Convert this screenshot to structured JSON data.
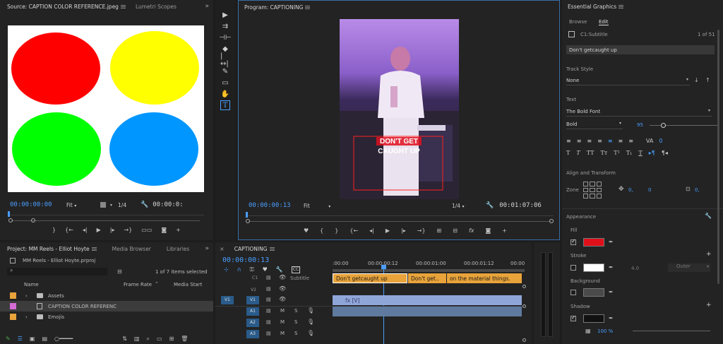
{
  "source": {
    "tab_label": "Source: CAPTION COLOR REFERENCE.jpeg",
    "tab2_label": "Lumetri Scopes",
    "timecode": "00:00:00:00",
    "fit_label": "Fit",
    "ratio_label": "1/4",
    "right_timecode": "00:00:0:",
    "circles": [
      {
        "name": "red-circle",
        "color": "#ff0000"
      },
      {
        "name": "yellow-circle",
        "color": "#ffff00"
      },
      {
        "name": "green-circle",
        "color": "#00ff00"
      },
      {
        "name": "blue-circle",
        "color": "#0096ff"
      }
    ]
  },
  "program": {
    "tab_label": "Program: CAPTIONING",
    "timecode": "00:00:00:13",
    "fit_label": "Fit",
    "ratio_label": "1/4",
    "duration": "00:01:07:06",
    "caption_line1": "DON'T GET",
    "caption_line2": "CAUGHT UP"
  },
  "essential": {
    "title": "Essential Graphics",
    "tab_browse": "Browse",
    "tab_edit": "Edit",
    "layer_name": "C1:Subtitle",
    "layer_count": "1 of 51",
    "text_value": "Don't getcaught up",
    "track_style_label": "Track Style",
    "track_style_value": "None",
    "text_section": "Text",
    "font_name": "The Bold Font",
    "font_style": "Bold",
    "font_size": "95",
    "tracking_value": "0",
    "align_section": "Align and Transform",
    "zone_label": "Zone",
    "pos_x": "0,",
    "pos_y": "0",
    "scale_value": "0,",
    "appearance_section": "Appearance",
    "fill_label": "Fill",
    "fill_color": "#e0101a",
    "stroke_label": "Stroke",
    "stroke_width": "4.0",
    "stroke_type": "Outer",
    "background_label": "Background",
    "shadow_label": "Shadow",
    "opacity_value": "100 %"
  },
  "project": {
    "tab_label": "Project: MM Reels - Elliot Hoyte",
    "tab2_label": "Media Browser",
    "tab3_label": "Libraries",
    "file_name": "MM Reels - Elliot Hoyte.prproj",
    "items_selected": "1 of 7 items selected",
    "col_name": "Name",
    "col_framerate": "Frame Rate",
    "col_mediastart": "Media Start",
    "rows": [
      {
        "label": "Assets",
        "color": "#e8a33a",
        "type": "folder"
      },
      {
        "label": "CAPTION COLOR REFERENC",
        "color": "#d46bd6",
        "type": "file"
      },
      {
        "label": "Emojis",
        "color": "#e8a33a",
        "type": "folder"
      }
    ]
  },
  "timeline": {
    "tab_label": "CAPTIONING",
    "timecode": "00:00:00:13",
    "ruler": [
      ":00:00",
      "00:00:00:12",
      "00:00:01:00",
      "00:00:01:12",
      "00:00"
    ],
    "subtitle_track": "Subtitle",
    "tracks": [
      "V2",
      "V1",
      "A1",
      "A2",
      "A3"
    ],
    "c1_label": "C1",
    "v1_src": "V1",
    "subtitle_clips": [
      "Don't getcaught up",
      "Don't get..",
      "on the material things."
    ],
    "video_clip": "fx  [V]"
  }
}
